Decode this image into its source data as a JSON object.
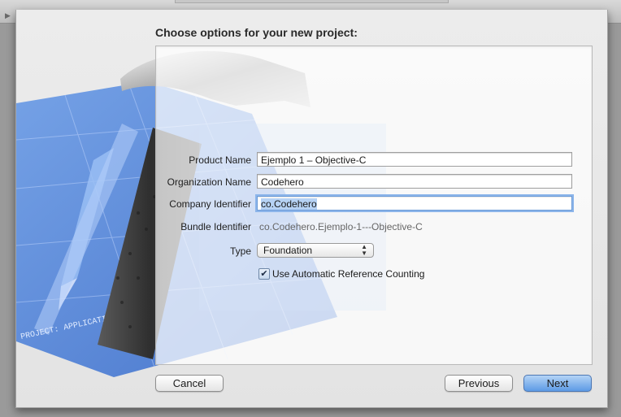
{
  "heading": "Choose options for your new project:",
  "form": {
    "product_name_label": "Product Name",
    "product_name_value": "Ejemplo 1 – Objective-C",
    "organization_name_label": "Organization Name",
    "organization_name_value": "Codehero",
    "company_identifier_label": "Company Identifier",
    "company_identifier_value": "co.Codehero",
    "bundle_identifier_label": "Bundle Identifier",
    "bundle_identifier_value": "co.Codehero.Ejemplo-1---Objective-C",
    "type_label": "Type",
    "type_value": "Foundation",
    "arc_label": "Use Automatic Reference Counting",
    "arc_checked": true
  },
  "buttons": {
    "cancel": "Cancel",
    "previous": "Previous",
    "next": "Next"
  },
  "artwork": {
    "blueprint_text": "PROJECT: APPLICATION.APP",
    "blueprint_color": "#4d7fd6"
  },
  "colors": {
    "accent": "#5d9ae5",
    "focus_ring": "#8cb5ea"
  },
  "icons": {
    "type_popup": "up-down-arrows-icon",
    "checkbox": "checkmark-icon"
  }
}
